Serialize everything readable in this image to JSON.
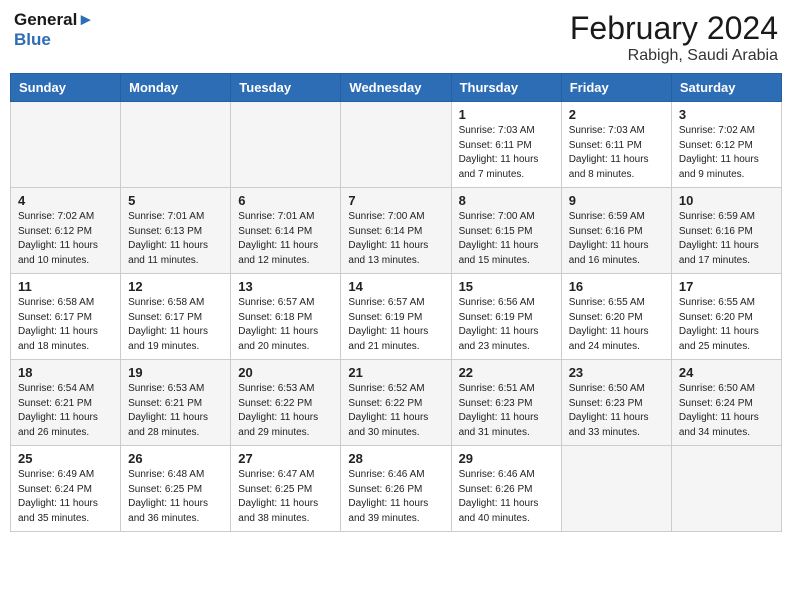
{
  "header": {
    "logo_line1": "General",
    "logo_line2": "Blue",
    "month_year": "February 2024",
    "location": "Rabigh, Saudi Arabia"
  },
  "days_of_week": [
    "Sunday",
    "Monday",
    "Tuesday",
    "Wednesday",
    "Thursday",
    "Friday",
    "Saturday"
  ],
  "weeks": [
    [
      {
        "day": "",
        "info": ""
      },
      {
        "day": "",
        "info": ""
      },
      {
        "day": "",
        "info": ""
      },
      {
        "day": "",
        "info": ""
      },
      {
        "day": "1",
        "info": "Sunrise: 7:03 AM\nSunset: 6:11 PM\nDaylight: 11 hours and 7 minutes."
      },
      {
        "day": "2",
        "info": "Sunrise: 7:03 AM\nSunset: 6:11 PM\nDaylight: 11 hours and 8 minutes."
      },
      {
        "day": "3",
        "info": "Sunrise: 7:02 AM\nSunset: 6:12 PM\nDaylight: 11 hours and 9 minutes."
      }
    ],
    [
      {
        "day": "4",
        "info": "Sunrise: 7:02 AM\nSunset: 6:12 PM\nDaylight: 11 hours and 10 minutes."
      },
      {
        "day": "5",
        "info": "Sunrise: 7:01 AM\nSunset: 6:13 PM\nDaylight: 11 hours and 11 minutes."
      },
      {
        "day": "6",
        "info": "Sunrise: 7:01 AM\nSunset: 6:14 PM\nDaylight: 11 hours and 12 minutes."
      },
      {
        "day": "7",
        "info": "Sunrise: 7:00 AM\nSunset: 6:14 PM\nDaylight: 11 hours and 13 minutes."
      },
      {
        "day": "8",
        "info": "Sunrise: 7:00 AM\nSunset: 6:15 PM\nDaylight: 11 hours and 15 minutes."
      },
      {
        "day": "9",
        "info": "Sunrise: 6:59 AM\nSunset: 6:16 PM\nDaylight: 11 hours and 16 minutes."
      },
      {
        "day": "10",
        "info": "Sunrise: 6:59 AM\nSunset: 6:16 PM\nDaylight: 11 hours and 17 minutes."
      }
    ],
    [
      {
        "day": "11",
        "info": "Sunrise: 6:58 AM\nSunset: 6:17 PM\nDaylight: 11 hours and 18 minutes."
      },
      {
        "day": "12",
        "info": "Sunrise: 6:58 AM\nSunset: 6:17 PM\nDaylight: 11 hours and 19 minutes."
      },
      {
        "day": "13",
        "info": "Sunrise: 6:57 AM\nSunset: 6:18 PM\nDaylight: 11 hours and 20 minutes."
      },
      {
        "day": "14",
        "info": "Sunrise: 6:57 AM\nSunset: 6:19 PM\nDaylight: 11 hours and 21 minutes."
      },
      {
        "day": "15",
        "info": "Sunrise: 6:56 AM\nSunset: 6:19 PM\nDaylight: 11 hours and 23 minutes."
      },
      {
        "day": "16",
        "info": "Sunrise: 6:55 AM\nSunset: 6:20 PM\nDaylight: 11 hours and 24 minutes."
      },
      {
        "day": "17",
        "info": "Sunrise: 6:55 AM\nSunset: 6:20 PM\nDaylight: 11 hours and 25 minutes."
      }
    ],
    [
      {
        "day": "18",
        "info": "Sunrise: 6:54 AM\nSunset: 6:21 PM\nDaylight: 11 hours and 26 minutes."
      },
      {
        "day": "19",
        "info": "Sunrise: 6:53 AM\nSunset: 6:21 PM\nDaylight: 11 hours and 28 minutes."
      },
      {
        "day": "20",
        "info": "Sunrise: 6:53 AM\nSunset: 6:22 PM\nDaylight: 11 hours and 29 minutes."
      },
      {
        "day": "21",
        "info": "Sunrise: 6:52 AM\nSunset: 6:22 PM\nDaylight: 11 hours and 30 minutes."
      },
      {
        "day": "22",
        "info": "Sunrise: 6:51 AM\nSunset: 6:23 PM\nDaylight: 11 hours and 31 minutes."
      },
      {
        "day": "23",
        "info": "Sunrise: 6:50 AM\nSunset: 6:23 PM\nDaylight: 11 hours and 33 minutes."
      },
      {
        "day": "24",
        "info": "Sunrise: 6:50 AM\nSunset: 6:24 PM\nDaylight: 11 hours and 34 minutes."
      }
    ],
    [
      {
        "day": "25",
        "info": "Sunrise: 6:49 AM\nSunset: 6:24 PM\nDaylight: 11 hours and 35 minutes."
      },
      {
        "day": "26",
        "info": "Sunrise: 6:48 AM\nSunset: 6:25 PM\nDaylight: 11 hours and 36 minutes."
      },
      {
        "day": "27",
        "info": "Sunrise: 6:47 AM\nSunset: 6:25 PM\nDaylight: 11 hours and 38 minutes."
      },
      {
        "day": "28",
        "info": "Sunrise: 6:46 AM\nSunset: 6:26 PM\nDaylight: 11 hours and 39 minutes."
      },
      {
        "day": "29",
        "info": "Sunrise: 6:46 AM\nSunset: 6:26 PM\nDaylight: 11 hours and 40 minutes."
      },
      {
        "day": "",
        "info": ""
      },
      {
        "day": "",
        "info": ""
      }
    ]
  ]
}
